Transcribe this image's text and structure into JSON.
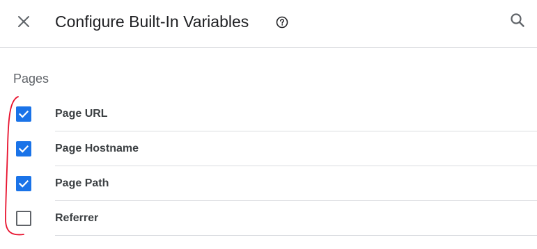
{
  "header": {
    "title": "Configure Built-In Variables",
    "close_icon": "close-icon",
    "help_icon": "help-circle-icon",
    "search_icon": "search-icon"
  },
  "section": {
    "label": "Pages",
    "items": [
      {
        "label": "Page URL",
        "checked": true
      },
      {
        "label": "Page Hostname",
        "checked": true
      },
      {
        "label": "Page Path",
        "checked": true
      },
      {
        "label": "Referrer",
        "checked": false
      }
    ]
  },
  "colors": {
    "checkbox_accent": "#1a73e8",
    "annotation_stroke": "#e8112d"
  }
}
